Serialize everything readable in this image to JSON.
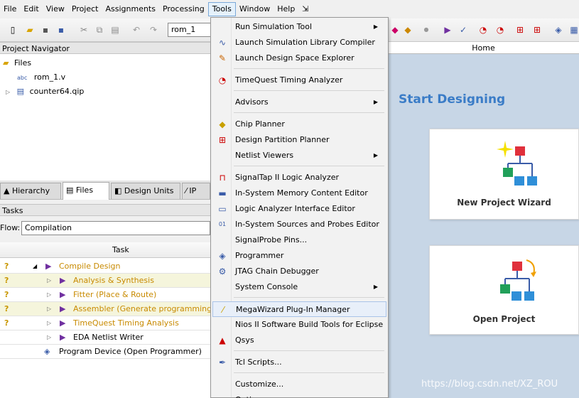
{
  "menubar": {
    "items": [
      "File",
      "Edit",
      "View",
      "Project",
      "Assignments",
      "Processing",
      "Tools",
      "Window",
      "Help"
    ],
    "open_item": "Tools"
  },
  "toolbar": {
    "entity_combo": "rom_1"
  },
  "project_navigator": {
    "title": "Project Navigator",
    "root": "Files",
    "files": [
      "rom_1.v",
      "counter64.qip"
    ]
  },
  "tabs": [
    {
      "label": "Hierarchy",
      "icon": "hierarchy-icon"
    },
    {
      "label": "Files",
      "icon": "files-icon",
      "active": true
    },
    {
      "label": "Design Units",
      "icon": "design-units-icon"
    },
    {
      "label": "IP",
      "icon": "ip-icon"
    }
  ],
  "tasks": {
    "title": "Tasks",
    "flow_label": "Flow:",
    "flow_value": "Compilation",
    "column_header": "Task",
    "rows": [
      {
        "label": "Compile Design",
        "status": "?",
        "level": 0,
        "color": "orange"
      },
      {
        "label": "Analysis & Synthesis",
        "status": "?",
        "level": 1,
        "color": "orange"
      },
      {
        "label": "Fitter (Place & Route)",
        "status": "?",
        "level": 1,
        "color": "orange"
      },
      {
        "label": "Assembler (Generate programming files)",
        "status": "?",
        "level": 1,
        "color": "orange"
      },
      {
        "label": "TimeQuest Timing Analysis",
        "status": "?",
        "level": 1,
        "color": "orange"
      },
      {
        "label": "EDA Netlist Writer",
        "status": "",
        "level": 1,
        "color": "black"
      },
      {
        "label": "Program Device (Open Programmer)",
        "status": "",
        "level": 0,
        "color": "black"
      }
    ]
  },
  "home": {
    "tab_label": "Home",
    "heading": "Start Designing",
    "cards": [
      {
        "label": "New Project Wizard",
        "icon": "new-project-wizard-icon"
      },
      {
        "label": "Open Project",
        "icon": "open-project-icon"
      }
    ]
  },
  "tools_menu": {
    "items": [
      {
        "label": "Run Simulation Tool",
        "icon": "",
        "submenu": true
      },
      {
        "label": "Launch Simulation Library Compiler",
        "icon": "simulation-library-icon"
      },
      {
        "label": "Launch Design Space Explorer",
        "icon": "design-space-explorer-icon"
      },
      {
        "sep": true
      },
      {
        "label": "TimeQuest Timing Analyzer",
        "icon": "timequest-clock-icon"
      },
      {
        "sep": true
      },
      {
        "label": "Advisors",
        "icon": "",
        "submenu": true
      },
      {
        "sep": true
      },
      {
        "label": "Chip Planner",
        "icon": "chip-planner-icon"
      },
      {
        "label": "Design Partition Planner",
        "icon": "partition-planner-icon"
      },
      {
        "label": "Netlist Viewers",
        "icon": "",
        "submenu": true
      },
      {
        "sep": true
      },
      {
        "label": "SignalTap II Logic Analyzer",
        "icon": "signaltap-icon"
      },
      {
        "label": "In-System Memory Content Editor",
        "icon": "memory-editor-icon"
      },
      {
        "label": "Logic Analyzer Interface Editor",
        "icon": "logic-analyzer-icon"
      },
      {
        "label": "In-System Sources and Probes Editor",
        "icon": "sources-probes-icon"
      },
      {
        "label": "SignalProbe Pins...",
        "icon": ""
      },
      {
        "label": "Programmer",
        "icon": "programmer-icon"
      },
      {
        "label": "JTAG Chain Debugger",
        "icon": "jtag-debugger-icon"
      },
      {
        "label": "System Console",
        "icon": "",
        "submenu": true
      },
      {
        "sep": true
      },
      {
        "label": "MegaWizard Plug-In Manager",
        "icon": "megawizard-icon",
        "highlighted": true
      },
      {
        "label": "Nios II Software Build Tools for Eclipse",
        "icon": ""
      },
      {
        "label": "Qsys",
        "icon": "qsys-icon"
      },
      {
        "sep": true
      },
      {
        "label": "Tcl Scripts...",
        "icon": "tcl-scripts-icon"
      },
      {
        "sep": true
      },
      {
        "label": "Customize...",
        "icon": ""
      },
      {
        "label": "Options...",
        "icon": ""
      }
    ]
  },
  "watermark": "https://blog.csdn.net/XZ_ROU"
}
